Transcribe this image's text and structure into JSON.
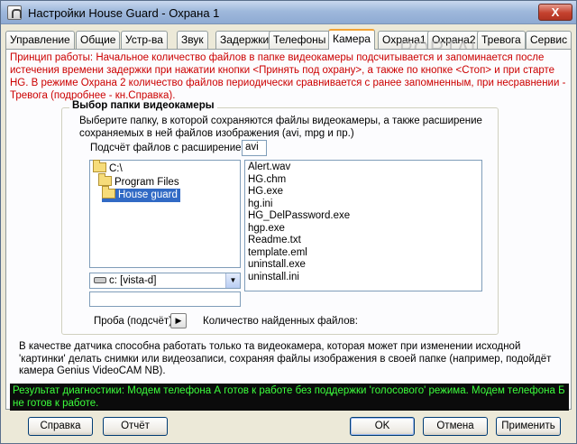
{
  "window": {
    "title": "Настройки House Guard - Охрана 1",
    "close_label": "X"
  },
  "tabs": [
    {
      "label": "Управление"
    },
    {
      "label": "Общие"
    },
    {
      "label": "Устр-ва"
    },
    {
      "label": "Звук"
    },
    {
      "label": "Задержки"
    },
    {
      "label": "Телефоны"
    },
    {
      "label": "Камера"
    },
    {
      "label": "Охрана1"
    },
    {
      "label": "Охрана2"
    },
    {
      "label": "Тревога"
    },
    {
      "label": "Сервис"
    }
  ],
  "active_tab": "Камера",
  "watermark": "PORTAL",
  "principle": "Принцип работы: Начальное количество файлов в папке видеокамеры подсчитывается и запоминается после истечения времени задержки при нажатии кнопки <Принять под охрану>, а также по кнопке <Стоп> и при старте HG. В режиме Охрана 2 количество файлов периодически сравнивается с ранее запомненным, при несравнении - Тревога (подробнее - кн.Справка).",
  "group": {
    "title": "Выбор папки видеокамеры",
    "description": "Выберите папку, в которой сохраняются файлы видеокамеры, а также расширение сохраняемых в ней файлов изображения (avi, mpg и пр.)",
    "ext_label": "Подсчёт файлов с расширением",
    "ext_value": "avi",
    "folders": [
      {
        "label": "C:\\",
        "indent": 0,
        "selected": false
      },
      {
        "label": "Program Files",
        "indent": 1,
        "selected": false
      },
      {
        "label": "House guard",
        "indent": 2,
        "selected": true
      }
    ],
    "files": [
      "Alert.wav",
      "HG.chm",
      "HG.exe",
      "hg.ini",
      "HG_DelPassword.exe",
      "hgp.exe",
      "Readme.txt",
      "template.eml",
      "uninstall.exe",
      "uninstall.ini"
    ],
    "drive": "c: [vista-d]",
    "path_value": "",
    "probe_label": "Проба (подсчёт):",
    "probe_button": "▶",
    "count_label": "Количество найденных файлов:"
  },
  "note": "В качестве датчика способна работать только та видеокамера, которая может при изменении исходной 'картинки' делать снимки или видеозаписи, сохраняя файлы изображения в своей папке (например, подойдёт камера Genius VideoCAM NB).",
  "status": "Результат диагностики: Модем телефона А готов к работе без поддержки 'голосового' режима. Модем телефона Б не готов к работе.",
  "buttons": {
    "help": "Справка",
    "report": "Отчёт",
    "ok": "OK",
    "cancel": "Отмена",
    "apply": "Применить"
  },
  "colors": {
    "status_bg": "#0b0b0b",
    "status_fg": "#3cff3c",
    "principle": "#cc0000",
    "selection": "#316ac5"
  }
}
